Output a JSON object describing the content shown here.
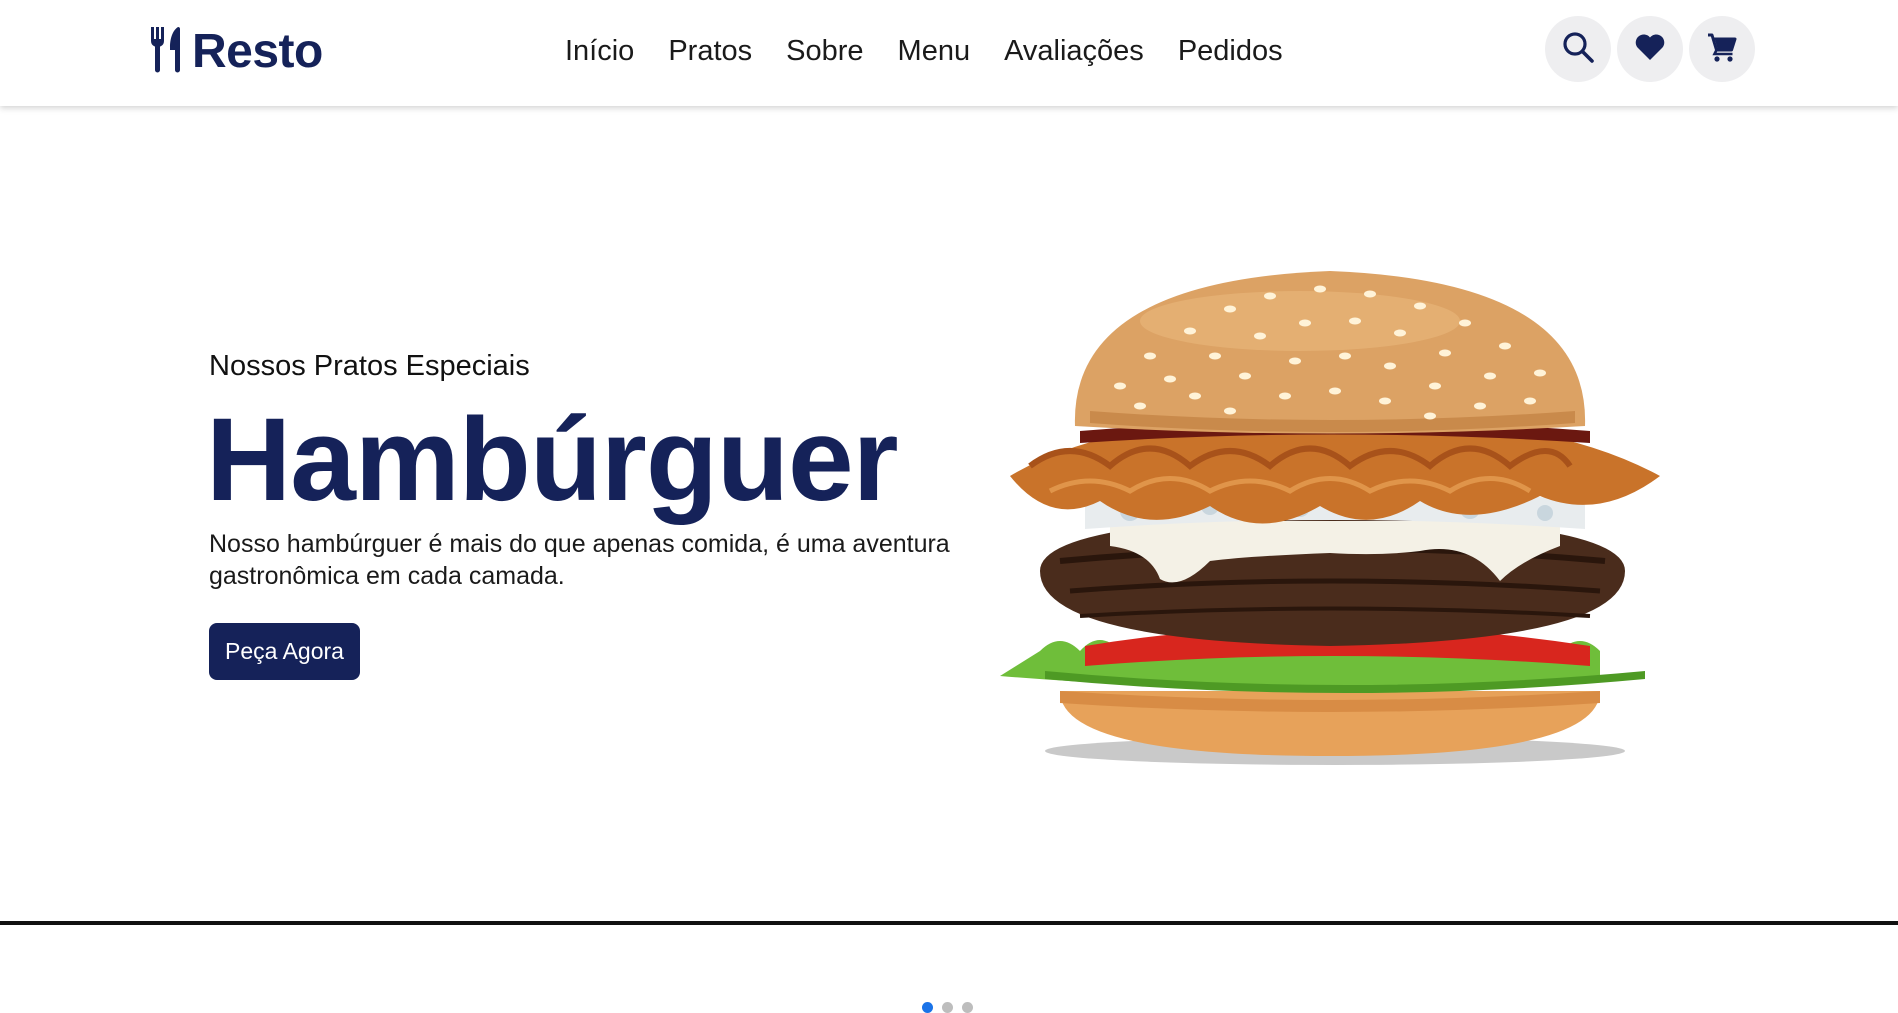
{
  "brand": {
    "name": "Resto",
    "icon": "utensils-icon",
    "color": "#152259"
  },
  "nav": {
    "items": [
      {
        "label": "Início"
      },
      {
        "label": "Pratos"
      },
      {
        "label": "Sobre"
      },
      {
        "label": "Menu"
      },
      {
        "label": "Avaliações"
      },
      {
        "label": "Pedidos"
      }
    ]
  },
  "header_icons": [
    {
      "name": "search-icon"
    },
    {
      "name": "heart-icon"
    },
    {
      "name": "cart-icon"
    }
  ],
  "hero": {
    "subtitle": "Nossos Pratos Especiais",
    "title": "Hambúrguer",
    "description": "Nosso hambúrguer é mais do que apenas comida, é uma aventura gastronômica em cada camada.",
    "cta_label": "Peça Agora",
    "image": "burger-image"
  },
  "carousel": {
    "slides": 3,
    "active": 1
  },
  "colors": {
    "primary": "#152259",
    "active_dot": "#1a73e8",
    "icon_bg": "#eeeef0"
  }
}
